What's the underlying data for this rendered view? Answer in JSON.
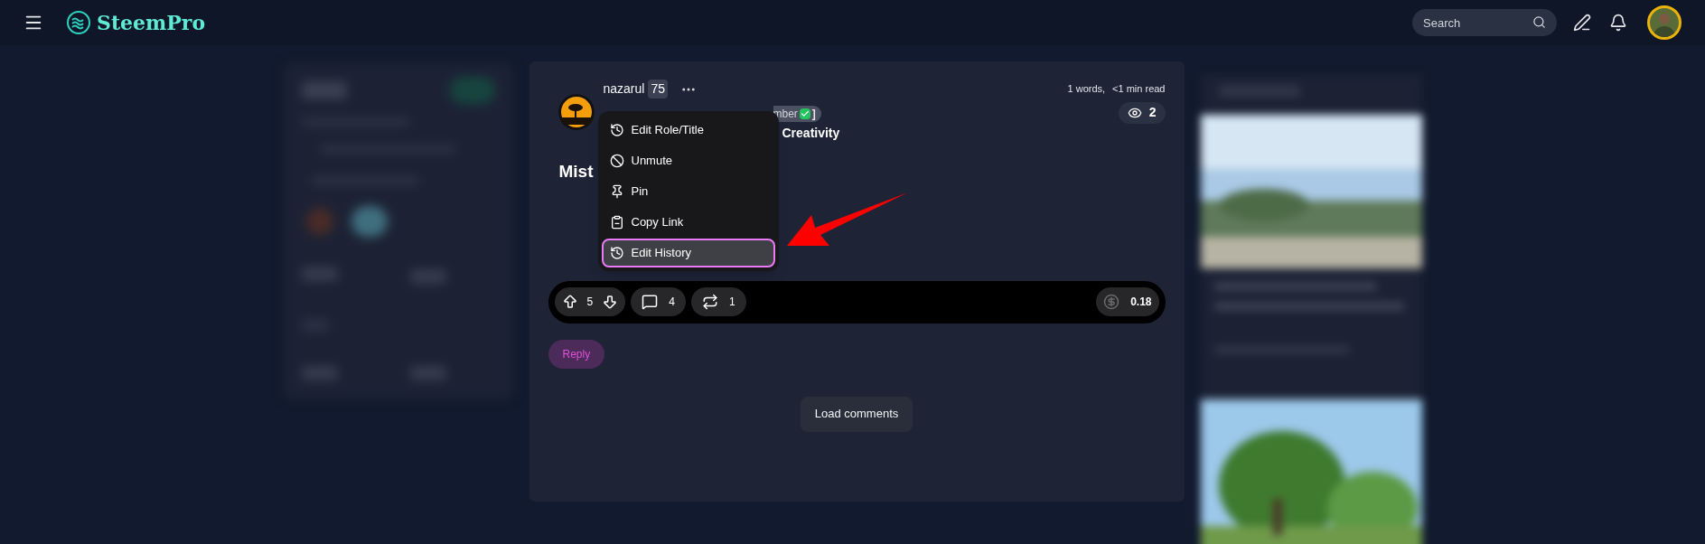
{
  "header": {
    "logo": "SteemPro",
    "search": {
      "placeholder": "Search"
    }
  },
  "post": {
    "author": "nazarul",
    "reputation": "75",
    "badge_fragment": "mber",
    "badge_close": "]",
    "community_fragment": "Creativity",
    "title_fragment": "Mist",
    "word_count": "1 words,",
    "read_time": "<1 min read",
    "views": "2",
    "menu": [
      {
        "label": "Edit Role/Title",
        "selected": false
      },
      {
        "label": "Unmute",
        "selected": false
      },
      {
        "label": "Pin",
        "selected": false
      },
      {
        "label": "Copy Link",
        "selected": false
      },
      {
        "label": "Edit History",
        "selected": true
      }
    ],
    "actions": {
      "upvotes": "5",
      "comments": "4",
      "reposts": "1",
      "payout": "0.18"
    },
    "reply": "Reply"
  },
  "load_comments": "Load comments"
}
